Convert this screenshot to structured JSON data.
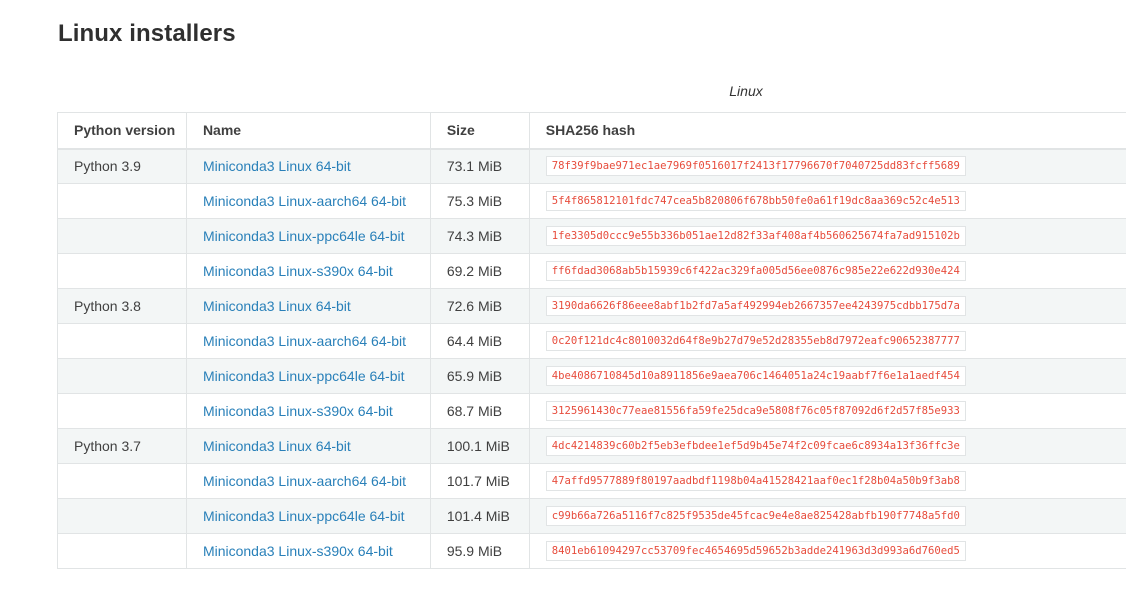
{
  "page": {
    "title": "Linux installers"
  },
  "table": {
    "caption": "Linux",
    "headers": [
      "Python version",
      "Name",
      "Size",
      "SHA256 hash"
    ],
    "rows": [
      {
        "version": "Python 3.9",
        "name": "Miniconda3 Linux 64-bit",
        "size": "73.1 MiB",
        "hash": "78f39f9bae971ec1ae7969f0516017f2413f17796670f7040725dd83fcff5689"
      },
      {
        "version": "",
        "name": "Miniconda3 Linux-aarch64 64-bit",
        "size": "75.3 MiB",
        "hash": "5f4f865812101fdc747cea5b820806f678bb50fe0a61f19dc8aa369c52c4e513"
      },
      {
        "version": "",
        "name": "Miniconda3 Linux-ppc64le 64-bit",
        "size": "74.3 MiB",
        "hash": "1fe3305d0ccc9e55b336b051ae12d82f33af408af4b560625674fa7ad915102b"
      },
      {
        "version": "",
        "name": "Miniconda3 Linux-s390x 64-bit",
        "size": "69.2 MiB",
        "hash": "ff6fdad3068ab5b15939c6f422ac329fa005d56ee0876c985e22e622d930e424"
      },
      {
        "version": "Python 3.8",
        "name": "Miniconda3 Linux 64-bit",
        "size": "72.6 MiB",
        "hash": "3190da6626f86eee8abf1b2fd7a5af492994eb2667357ee4243975cdbb175d7a"
      },
      {
        "version": "",
        "name": "Miniconda3 Linux-aarch64 64-bit",
        "size": "64.4 MiB",
        "hash": "0c20f121dc4c8010032d64f8e9b27d79e52d28355eb8d7972eafc90652387777"
      },
      {
        "version": "",
        "name": "Miniconda3 Linux-ppc64le 64-bit",
        "size": "65.9 MiB",
        "hash": "4be4086710845d10a8911856e9aea706c1464051a24c19aabf7f6e1a1aedf454"
      },
      {
        "version": "",
        "name": "Miniconda3 Linux-s390x 64-bit",
        "size": "68.7 MiB",
        "hash": "3125961430c77eae81556fa59fe25dca9e5808f76c05f87092d6f2d57f85e933"
      },
      {
        "version": "Python 3.7",
        "name": "Miniconda3 Linux 64-bit",
        "size": "100.1 MiB",
        "hash": "4dc4214839c60b2f5eb3efbdee1ef5d9b45e74f2c09fcae6c8934a13f36ffc3e"
      },
      {
        "version": "",
        "name": "Miniconda3 Linux-aarch64 64-bit",
        "size": "101.7 MiB",
        "hash": "47affd9577889f80197aadbdf1198b04a41528421aaf0ec1f28b04a50b9f3ab8"
      },
      {
        "version": "",
        "name": "Miniconda3 Linux-ppc64le 64-bit",
        "size": "101.4 MiB",
        "hash": "c99b66a726a5116f7c825f9535de45fcac9e4e8ae825428abfb190f7748a5fd0"
      },
      {
        "version": "",
        "name": "Miniconda3 Linux-s390x 64-bit",
        "size": "95.9 MiB",
        "hash": "8401eb61094297cc53709fec4654695d59652b3adde241963d3d993a6d760ed5"
      }
    ]
  },
  "colors": {
    "link": "#2980b9",
    "hash_text": "#e74c3c",
    "stripe": "#f3f6f6",
    "border": "#e1e4e5"
  }
}
